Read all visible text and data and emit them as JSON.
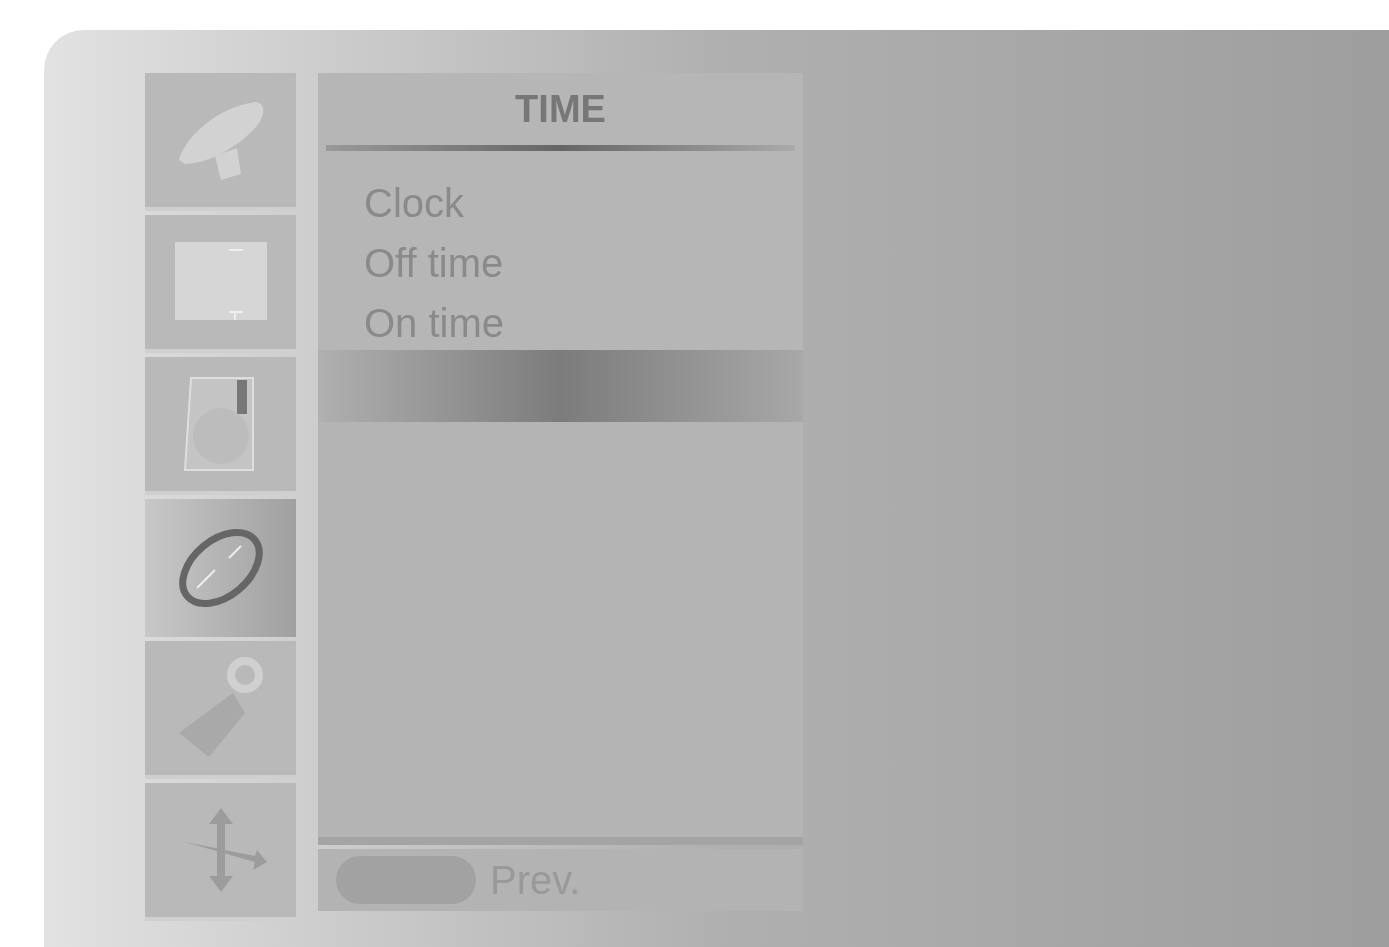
{
  "sidebar": {
    "items": [
      {
        "kind": "dish",
        "selected": false
      },
      {
        "kind": "screen",
        "selected": false
      },
      {
        "kind": "speaker",
        "selected": false
      },
      {
        "kind": "ring",
        "selected": true
      },
      {
        "kind": "tag",
        "selected": false
      },
      {
        "kind": "arrows",
        "selected": false
      }
    ]
  },
  "menu": {
    "title": "TIME",
    "items": [
      "Clock",
      "Off time",
      "On time"
    ]
  },
  "footer": {
    "hint": "Prev."
  }
}
